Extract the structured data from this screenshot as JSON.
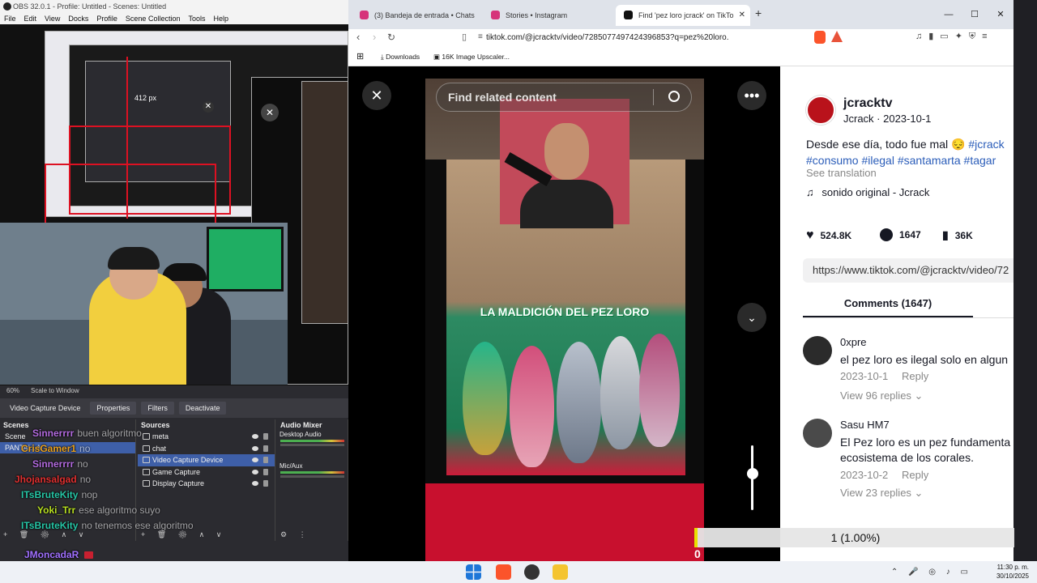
{
  "obs": {
    "title": "OBS 32.0.1 - Profile: Untitled - Scenes: Untitled",
    "menu": [
      "File",
      "Edit",
      "View",
      "Docks",
      "Profile",
      "Scene Collection",
      "Tools",
      "Help"
    ],
    "preview_size_label": "412 px",
    "zoom": "60%",
    "scale_mode": "Scale to Window",
    "source_toolbar": {
      "device": "Video Capture Device",
      "properties": "Properties",
      "filters": "Filters",
      "deactivate": "Deactivate"
    },
    "scenes_header": "Scenes",
    "scene_label": "Scene",
    "scenes": [
      "PANTALLA"
    ],
    "sources_header": "Sources",
    "sources": [
      {
        "name": "meta",
        "selected": false
      },
      {
        "name": "chat",
        "selected": false
      },
      {
        "name": "Video Capture Device",
        "selected": true
      },
      {
        "name": "Game Capture",
        "selected": false
      },
      {
        "name": "Display Capture",
        "selected": false
      }
    ],
    "mixer_header": "Audio Mixer",
    "mixer_channels": [
      "Desktop Audio",
      "Mic/Aux"
    ]
  },
  "chat": [
    {
      "user": "Sinnerrrr",
      "msg": "buen algoritmo",
      "color": "#b36be0"
    },
    {
      "user": "CrisGamer1",
      "msg": "no",
      "color": "#e8a020"
    },
    {
      "user": "Sinnerrrr",
      "msg": "no",
      "color": "#b36be0"
    },
    {
      "user": "Jhojansalgad",
      "msg": "no",
      "color": "#e03030"
    },
    {
      "user": "ITsBruteKity",
      "msg": "nop",
      "color": "#26c6a6"
    },
    {
      "user": "Yoki_Trr",
      "msg": "ese algoritmo suyo",
      "color": "#b8e020"
    },
    {
      "user": "ITsBruteKity",
      "msg": "no tenemos ese algoritmo",
      "color": "#26c6a6"
    },
    {
      "user": "JMoncadaR",
      "msg": "",
      "color": "#a070ff"
    },
    {
      "user": "JMoncadaR",
      "msg": "",
      "color": "#a070ff"
    }
  ],
  "browser": {
    "tabs": [
      {
        "title": "(3) Bandeja de entrada • Chats",
        "color": "#d6337a"
      },
      {
        "title": "Stories • Instagram",
        "color": "#d6337a"
      },
      {
        "title": "Find 'pez loro jcrack' on TikTo",
        "color": "#111111"
      }
    ],
    "url": "tiktok.com/@jcracktv/video/7285077497424396853?q=pez%20loro...",
    "bookmarks": [
      "Downloads",
      "16K Image Upscaler..."
    ]
  },
  "tiktok": {
    "search_placeholder": "Find related content",
    "video_caption": "LA MALDICIÓN DEL PEZ LORO",
    "username": "jcracktv",
    "sub": "Jcrack · 2023-10-1",
    "desc_text": "Desde ese día, todo fue mal 😔 ",
    "desc_tag1": "#jcrack",
    "desc_tags2": "#consumo #ilegal #santamarta #tagar",
    "see_translation": "See translation",
    "sound": "sonido original - Jcrack",
    "likes": "524.8K",
    "comments_count": "1647",
    "saves": "36K",
    "link": "https://www.tiktok.com/@jcracktv/video/72",
    "comments_tab": "Comments (1647)",
    "comments": [
      {
        "user": "0xpre",
        "text": "el pez loro es ilegal solo en algun",
        "date": "2023-10-1",
        "reply": "Reply",
        "view": "View 96 replies"
      },
      {
        "user": "Sasu HM7",
        "text": "El Pez loro es un pez fundamenta",
        "text2": "ecosistema de los corales.",
        "date": "2023-10-2",
        "reply": "Reply",
        "view": "View 23 replies"
      }
    ]
  },
  "counter": {
    "text": "1 (1.00%)",
    "value": "0"
  },
  "taskbar": {
    "time": "11:30 p. m.",
    "date": "30/10/2025"
  }
}
